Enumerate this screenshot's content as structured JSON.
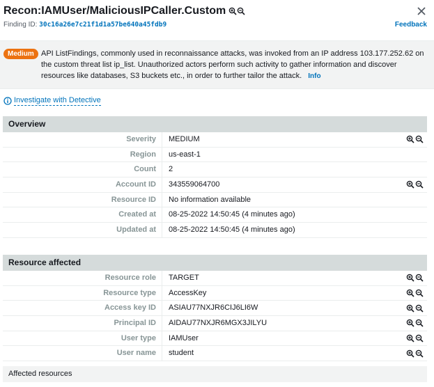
{
  "header": {
    "title": "Recon:IAMUser/MaliciousIPCaller.Custom",
    "finding_id_label": "Finding ID:",
    "finding_id": "30c16a26e7c21f1d1a57be640a45fdb9",
    "feedback": "Feedback"
  },
  "summary": {
    "severity_badge": "Medium",
    "description": "API ListFindings, commonly used in reconnaissance attacks, was invoked from an IP address 103.177.252.62 on the custom threat list ip_list. Unauthorized actors perform such activity to gather information and discover resources like databases, S3 buckets etc., in order to further tailor the attack.",
    "info_link": "Info"
  },
  "investigate_link": "Investigate with Detective",
  "overview": {
    "title": "Overview",
    "rows": [
      {
        "label": "Severity",
        "value": "MEDIUM"
      },
      {
        "label": "Region",
        "value": "us-east-1"
      },
      {
        "label": "Count",
        "value": "2"
      },
      {
        "label": "Account ID",
        "value": "343559064700"
      },
      {
        "label": "Resource ID",
        "value": "No information available"
      },
      {
        "label": "Created at",
        "value": "08-25-2022 14:50:45 (4 minutes ago)"
      },
      {
        "label": "Updated at",
        "value": "08-25-2022 14:50:45 (4 minutes ago)"
      }
    ]
  },
  "resource": {
    "title": "Resource affected",
    "rows": [
      {
        "label": "Resource role",
        "value": "TARGET"
      },
      {
        "label": "Resource type",
        "value": "AccessKey"
      },
      {
        "label": "Access key ID",
        "value": "ASIAU77NXJR6CIJ6LI6W"
      },
      {
        "label": "Principal ID",
        "value": "AIDAU77NXJR6MGX3JILYU"
      },
      {
        "label": "User type",
        "value": "IAMUser"
      },
      {
        "label": "User name",
        "value": "student"
      }
    ]
  },
  "affected_resources": "Affected resources",
  "colors": {
    "badge": "#ec7211",
    "link": "#0073bb",
    "section_header": "#d5dbdb"
  },
  "icons": {
    "zoom_in": "zoom-in-icon",
    "zoom_out": "zoom-out-icon",
    "close": "close-icon",
    "info": "info-icon"
  }
}
